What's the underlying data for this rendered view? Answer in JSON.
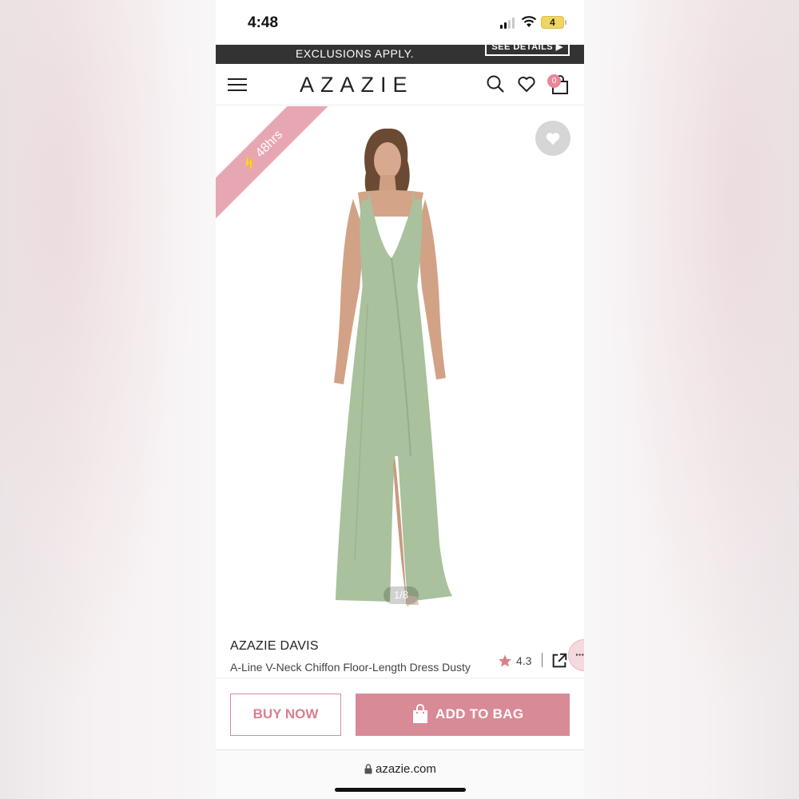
{
  "status_bar": {
    "time": "4:48",
    "battery": "4"
  },
  "promo": {
    "text": "EXCLUSIONS APPLY.",
    "button": "SEE DETAILS ▶"
  },
  "header": {
    "logo": "AZAZIE",
    "bag_count": "0"
  },
  "image": {
    "badge": "48hrs",
    "pager": "1/8"
  },
  "product": {
    "brand": "AZAZIE DAVIS",
    "description": "A-Line V-Neck Chiffon Floor-Length Dress Dusty",
    "rating": "4.3"
  },
  "actions": {
    "buy_now": "BUY NOW",
    "add_to_bag": "ADD TO BAG"
  },
  "browser": {
    "url": "azazie.com"
  },
  "colors": {
    "accent": "#d98a97",
    "ribbon": "#e7a7b2",
    "dress": "#a9c19c",
    "dark_banner": "#333333"
  }
}
